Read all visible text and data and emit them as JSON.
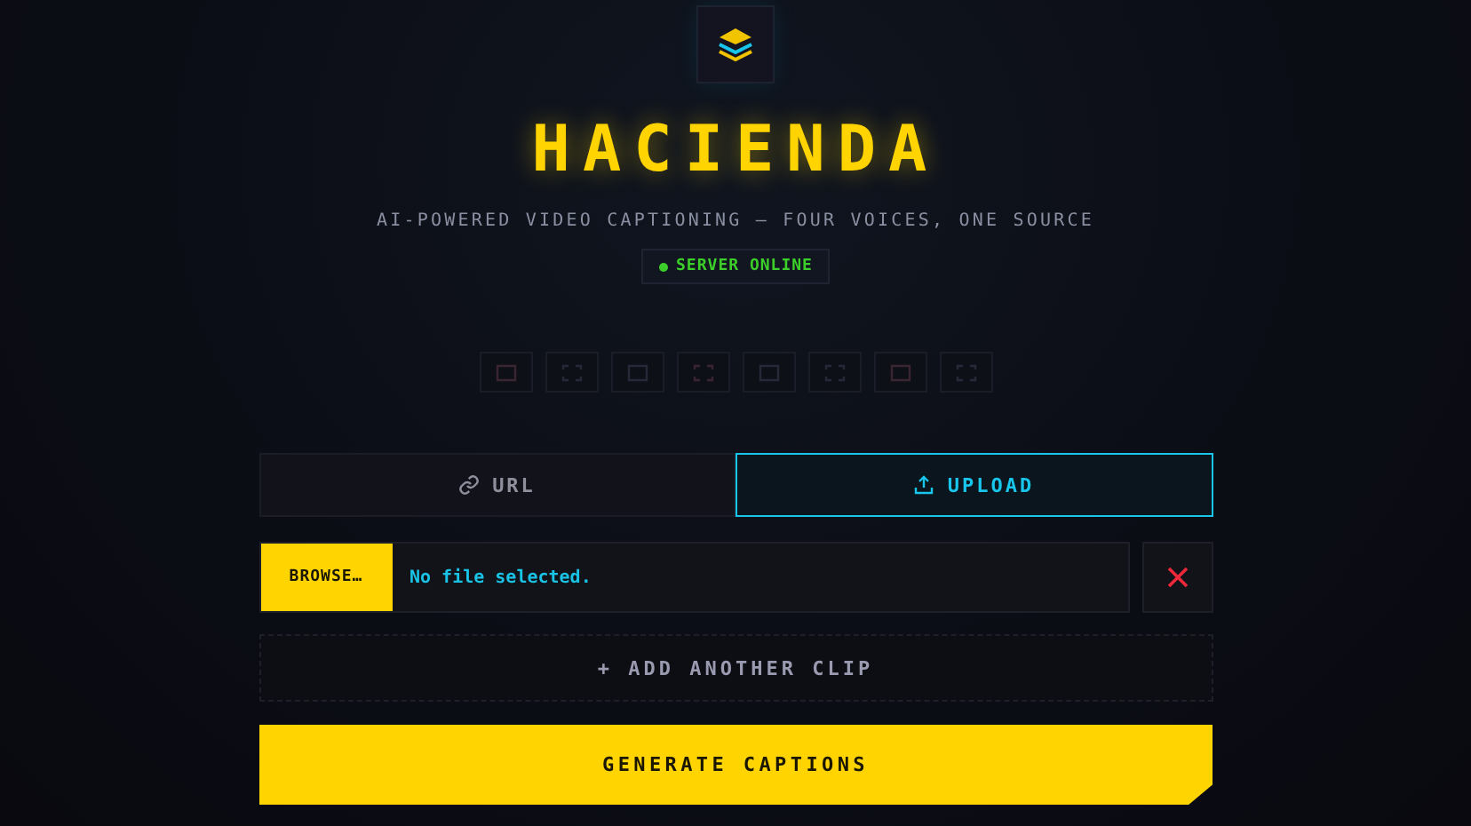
{
  "brand": {
    "title": "HACIENDA",
    "tagline": "AI-POWERED VIDEO CAPTIONING — FOUR VOICES, ONE SOURCE"
  },
  "status": {
    "label": "SERVER ONLINE",
    "online": true
  },
  "tool_tiles": [
    {
      "kind": "frame"
    },
    {
      "kind": "corners"
    },
    {
      "kind": "frame"
    },
    {
      "kind": "corners"
    },
    {
      "kind": "frame"
    },
    {
      "kind": "corners"
    },
    {
      "kind": "frame"
    },
    {
      "kind": "corners"
    }
  ],
  "tabs": [
    {
      "label": "URL",
      "kind": "link",
      "selected": false
    },
    {
      "label": "UPLOAD",
      "kind": "upload",
      "selected": true
    }
  ],
  "file_row": {
    "browse": "BROWSE…",
    "value": "No file selected."
  },
  "add_clip": "+ ADD ANOTHER CLIP",
  "submit": "GENERATE CAPTIONS"
}
